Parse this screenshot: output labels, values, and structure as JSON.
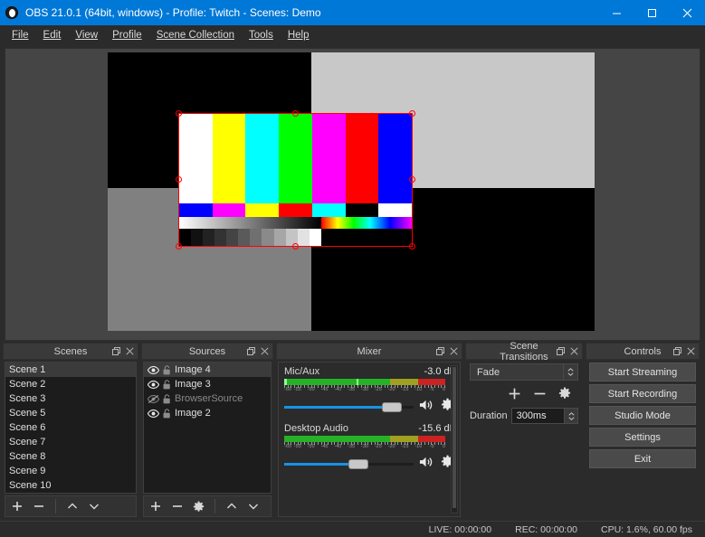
{
  "window": {
    "title": "OBS 21.0.1 (64bit, windows) - Profile: Twitch - Scenes: Demo",
    "logo_icon": "obs-logo-icon",
    "minimize_icon": "minimize-icon",
    "maximize_icon": "maximize-icon",
    "close_icon": "close-icon",
    "accent_color": "#0078d7"
  },
  "menubar": {
    "items": [
      {
        "label": "File",
        "mnemonic": "F"
      },
      {
        "label": "Edit",
        "mnemonic": "E"
      },
      {
        "label": "View",
        "mnemonic": "V"
      },
      {
        "label": "Profile",
        "mnemonic": "P"
      },
      {
        "label": "Scene Collection",
        "mnemonic": "S"
      },
      {
        "label": "Tools",
        "mnemonic": "T"
      },
      {
        "label": "Help",
        "mnemonic": "H"
      }
    ]
  },
  "preview": {
    "background_color": "#454545",
    "selection_color": "#ff0000",
    "canvas_quadrants": [
      "#000000",
      "#c8c8c8",
      "#808080",
      "#000000"
    ],
    "source_name": "Image 4",
    "colorbars_row1": [
      "#ffffff",
      "#ffff00",
      "#00ffff",
      "#00ff00",
      "#ff00ff",
      "#ff0000",
      "#0000ff"
    ],
    "colorbars_row2": [
      "#0000ff",
      "#ff00ff",
      "#ffff00",
      "#ff0000",
      "#00ffff",
      "#000000",
      "#ffffff"
    ],
    "gray_steps": [
      "#000000",
      "#111111",
      "#222222",
      "#333333",
      "#444444",
      "#5a5a5a",
      "#707070",
      "#8a8a8a",
      "#a6a6a6",
      "#c4c4c4",
      "#e2e2e2",
      "#ffffff"
    ],
    "handles": [
      "top-left",
      "top-center",
      "top-right",
      "middle-left",
      "middle-right",
      "bottom-left",
      "bottom-center",
      "bottom-right"
    ]
  },
  "docks": {
    "scenes": {
      "title": "Scenes",
      "float_icon": "float-icon",
      "close_icon": "close-icon",
      "items": [
        {
          "label": "Scene 1",
          "selected": true
        },
        {
          "label": "Scene 2",
          "selected": false
        },
        {
          "label": "Scene 3",
          "selected": false
        },
        {
          "label": "Scene 5",
          "selected": false
        },
        {
          "label": "Scene 6",
          "selected": false
        },
        {
          "label": "Scene 7",
          "selected": false
        },
        {
          "label": "Scene 8",
          "selected": false
        },
        {
          "label": "Scene 9",
          "selected": false
        },
        {
          "label": "Scene 10",
          "selected": false
        }
      ],
      "toolbar": {
        "add_icon": "plus-icon",
        "remove_icon": "minus-icon",
        "move_up_icon": "chevron-up-icon",
        "move_down_icon": "chevron-down-icon"
      }
    },
    "sources": {
      "title": "Sources",
      "float_icon": "float-icon",
      "close_icon": "close-icon",
      "items": [
        {
          "label": "Image 4",
          "visible": true,
          "locked": false,
          "selected": true
        },
        {
          "label": "Image 3",
          "visible": true,
          "locked": false,
          "selected": false
        },
        {
          "label": "BrowserSource",
          "visible": false,
          "locked": false,
          "selected": false
        },
        {
          "label": "Image 2",
          "visible": true,
          "locked": false,
          "selected": false
        }
      ],
      "toolbar": {
        "add_icon": "plus-icon",
        "remove_icon": "minus-icon",
        "properties_icon": "gear-icon",
        "move_up_icon": "chevron-up-icon",
        "move_down_icon": "chevron-down-icon"
      }
    },
    "mixer": {
      "title": "Mixer",
      "float_icon": "float-icon",
      "close_icon": "close-icon",
      "scale_labels": [
        "-60",
        "-55",
        "-50",
        "-45",
        "-40",
        "-35",
        "-30",
        "-25",
        "-20",
        "-15",
        "-10",
        "-5",
        "0"
      ],
      "channels": [
        {
          "name": "Desktop Audio",
          "level_db": "-15.6 dB",
          "meter_green_pct": 66,
          "meter_yellow_pct": 17,
          "meter_red_pct": 17,
          "fader_pct": 57,
          "peak_pct": null,
          "mute_icon": "speaker-icon",
          "settings_icon": "gear-icon"
        },
        {
          "name": "Mic/Aux",
          "level_db": "-3.0 dB",
          "meter_green_pct": 66,
          "meter_yellow_pct": 17,
          "meter_red_pct": 17,
          "fader_pct": 83,
          "peak_pct": 45,
          "mute_icon": "speaker-icon",
          "settings_icon": "gear-icon"
        }
      ]
    },
    "transitions": {
      "title": "Scene Transitions",
      "float_icon": "float-icon",
      "close_icon": "close-icon",
      "selected_transition": "Fade",
      "add_icon": "plus-icon",
      "remove_icon": "minus-icon",
      "properties_icon": "gear-icon",
      "duration_label": "Duration",
      "duration_value": "300ms"
    },
    "controls": {
      "title": "Controls",
      "float_icon": "float-icon",
      "close_icon": "close-icon",
      "buttons": [
        "Start Streaming",
        "Start Recording",
        "Studio Mode",
        "Settings",
        "Exit"
      ]
    }
  },
  "statusbar": {
    "live": "LIVE: 00:00:00",
    "rec": "REC: 00:00:00",
    "cpu": "CPU: 1.6%, 60.00 fps"
  }
}
